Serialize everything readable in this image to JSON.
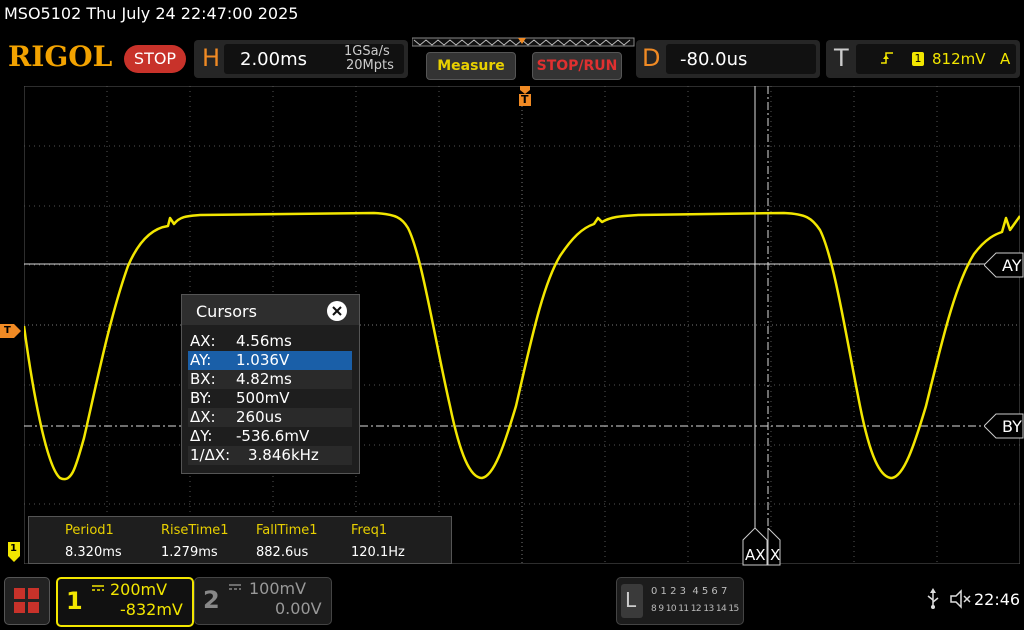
{
  "header": {
    "device_title": "MSO5102  Thu July 24 22:47:00 2025",
    "logo": "RIGOL",
    "run_state": "STOP",
    "horizontal": {
      "letter": "H",
      "scale": "2.00ms",
      "sample_rate": "1GSa/s",
      "memory_depth": "20Mpts"
    },
    "measure_label": "Measure",
    "stop_run_label": "STOP/RUN",
    "delay": {
      "letter": "D",
      "value": "-80.0us"
    },
    "trigger": {
      "letter": "T",
      "channel": "1",
      "level": "812mV",
      "mode": "A"
    }
  },
  "screen": {
    "trigger_marker": "T",
    "level_marker": "T",
    "ch_marker": "1",
    "cursor_tags": {
      "ay": "AY",
      "by": "BY",
      "ax": "AX",
      "bx": "X"
    }
  },
  "cursors": {
    "title": "Cursors",
    "close_icon": "close-icon",
    "rows": [
      {
        "k": "AX:",
        "v": "4.56ms"
      },
      {
        "k": "AY:",
        "v": "1.036V"
      },
      {
        "k": "BX:",
        "v": "4.82ms"
      },
      {
        "k": "BY:",
        "v": "500mV"
      },
      {
        "k": "ΔX:",
        "v": "260us"
      },
      {
        "k": "ΔY:",
        "v": "-536.6mV"
      },
      {
        "k": "1/ΔX:",
        "v": "3.846kHz"
      }
    ],
    "selected_index": 1
  },
  "measurements": [
    {
      "label": "Period1",
      "value": "8.320ms"
    },
    {
      "label": "RiseTime1",
      "value": "1.279ms"
    },
    {
      "label": "FallTime1",
      "value": "882.6us"
    },
    {
      "label": "Freq1",
      "value": "120.1Hz"
    }
  ],
  "footer": {
    "ch1": {
      "num": "1",
      "scale": "200mV",
      "offset": "-832mV"
    },
    "ch2": {
      "num": "2",
      "scale": "100mV",
      "offset": "0.00V"
    },
    "logic": {
      "letter": "L",
      "row1": "0 1 2 3  4 5 6 7",
      "row2": "8 9 10 11 12 13 14 15"
    },
    "time": "22:46"
  },
  "colors": {
    "ch1": "#f2e600",
    "accent": "#f08a24",
    "stop": "#c8322a",
    "selected_row": "#1a5fa8"
  }
}
